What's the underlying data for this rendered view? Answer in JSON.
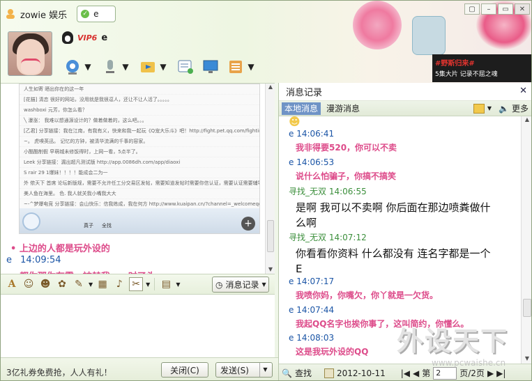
{
  "window": {
    "title": "zowie 娱乐",
    "status_value": "e",
    "buddy_name": "e",
    "vip_label": "VIP6"
  },
  "header_ad": {
    "line1": "#野斯归来#",
    "line2": "5集大片  记录不屈之魂"
  },
  "window_buttons": [
    "▢",
    "–",
    "▭",
    "✕"
  ],
  "toolbar_icons": [
    "video-call-icon",
    "voice-call-icon",
    "send-file-icon",
    "create-discussion-icon",
    "remote-assist-icon",
    "app-center-icon"
  ],
  "left_chat": {
    "screenshot_lines": [
      "人生如寄 晒出你在的这一年",
      "[花猫] 清恋  很好的网站，没用就是我很逗人，还让不让人活了。。。。。",
      "washboxi  元芳，你怎么看？",
      "╲ 瀑涨：  我难以想通源设计的？做着做着的，这么吧。。。",
      "[乙君]  分享链接：我在江南，有我有义，快来和我一起玩《Q宠大乐斗》吧！http://fight.pet.qq.com/fightindex.ht",
      "~。 虎嗅英迅。    记忆的方钟，被清华流满的千事的容家。",
      "小酷酷制假  早萌城未修饭得时，上网一看，5点半了。",
      "Leek  分享链接：漏出超凡测试版 http://app.0086dh.com/app/diaoxi",
      "S rair  29 1爆妹！！！！能成会二为一",
      "外 侬天下 首席  论坛新版规，需要不允许任工分交易区发帖，需要知道发帖时需要你信认证，需要认证需要辅导",
      "美人鱼在海里。  色.   我人就关我小嘴我大大",
      "~-^梦爆电竞  分享链接：会山快乐：信我练成，我在何方 http://www.kuaipan.cn/?channel=_welcomeqq",
      "渡话.小佳"
    ],
    "messages": [
      {
        "kind": "pink",
        "text": "• 上边的人都是玩外设的"
      },
      {
        "kind": "meta",
        "sender": "e",
        "time": "14:09:54"
      },
      {
        "kind": "pink",
        "text": "• 都你那你有零，被赫我，一时了头"
      }
    ],
    "screenshot_labels": [
      "真子",
      "全找"
    ]
  },
  "input_toolbar": {
    "icons": [
      "font-icon",
      "emoji-icon",
      "funny-face-icon",
      "magic-expression-icon",
      "scribble-icon",
      "picture-icon",
      "music-icon",
      "screenshot-icon",
      "toolbox-icon"
    ],
    "history_label": "消息记录"
  },
  "bottom": {
    "promo": "3亿礼券免费抢，人人有礼！",
    "close_label": "关闭(C)",
    "send_label": "发送(S)"
  },
  "right_panel": {
    "title": "消息记录",
    "tab_local": "本地消息",
    "tab_roam": "漫游消息",
    "more_label": "更多",
    "entries": [
      {
        "sender": "e",
        "time": "14:06:41",
        "text": "我非得要520，你可以不卖",
        "style": "pink"
      },
      {
        "sender": "e",
        "time": "14:06:53",
        "text": "说什么怕骗子，你搞不搞笑",
        "style": "pink"
      },
      {
        "sender": "寻找_无双",
        "time": "14:06:55",
        "text": "是啊  我可以不卖啊  你后面在那边喷粪做什么啊",
        "style": "big"
      },
      {
        "sender": "寻找_无双",
        "time": "14:07:12",
        "text": "你看看你资料  什么都没有 连名字都是一个 E",
        "style": "big"
      },
      {
        "sender": "e",
        "time": "14:07:17",
        "text": "我喷你妈，你嘴欠，你丫就是一欠货。",
        "style": "pink"
      },
      {
        "sender": "e",
        "time": "14:07:44",
        "text": "我起QQ名字也挨你事了，这叫简约，你懂么。",
        "style": "pink"
      },
      {
        "sender": "e",
        "time": "14:08:03",
        "text": "这是我玩外设的QQ",
        "style": "pink"
      }
    ],
    "footer": {
      "search_label": "查找",
      "date": "2012-10-11",
      "page_prefix": "第",
      "page_value": "2",
      "page_suffix": "页/2页"
    }
  },
  "watermark": {
    "title": "外设天下",
    "url": "www.pcwaishe.cn"
  },
  "colors": {
    "pink": "#dd4b8a",
    "blue": "#1b55a6",
    "green": "#3c8f3c",
    "accent": "#6f93c6"
  }
}
